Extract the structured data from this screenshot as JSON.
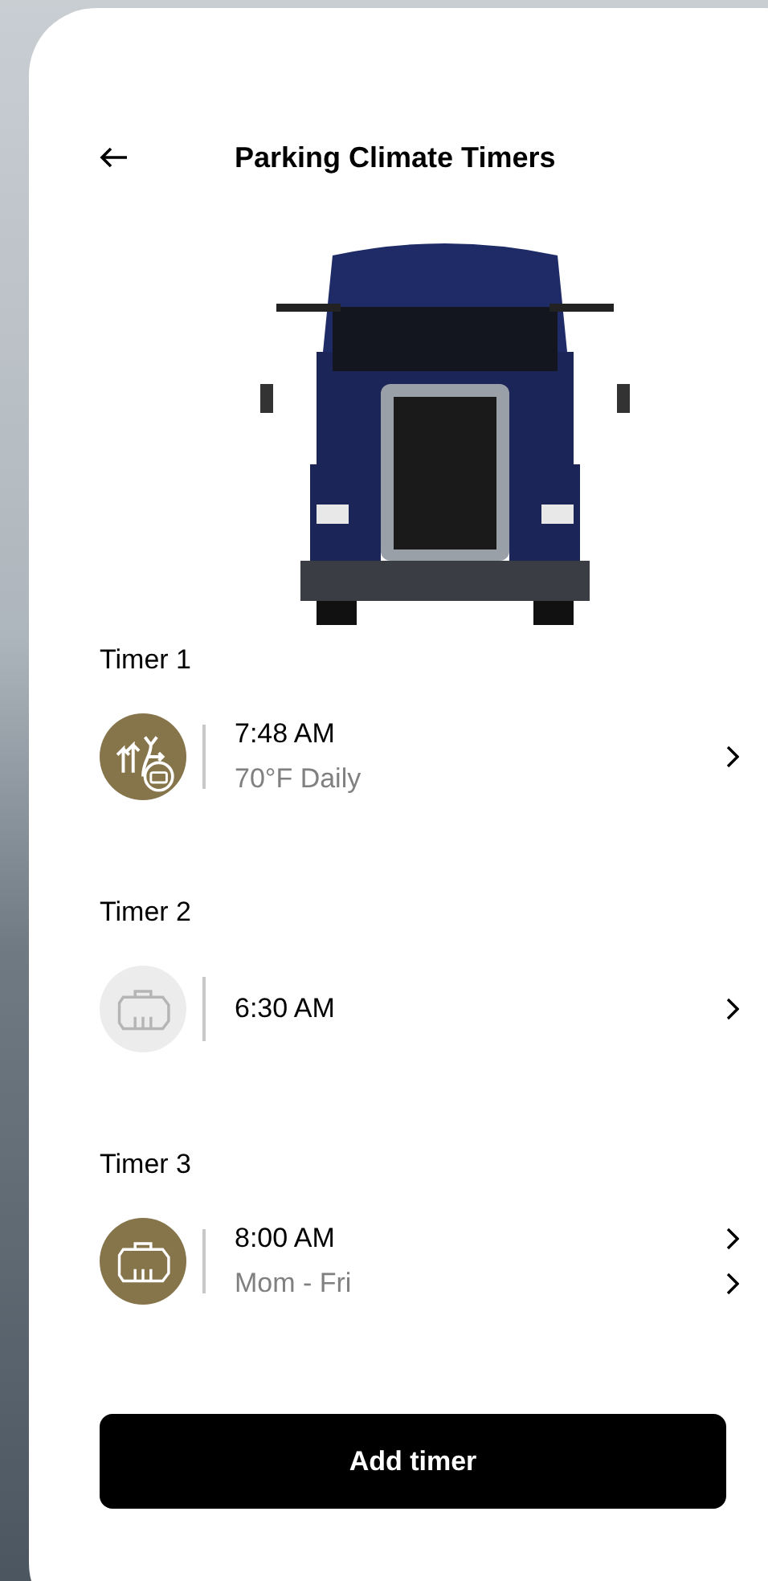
{
  "header": {
    "title": "Parking Climate Timers"
  },
  "timers": [
    {
      "label": "Timer 1",
      "kind": "climate",
      "active": true,
      "time": "7:48 AM",
      "detail": "70°F Daily",
      "chevrons": [
        {
          "kind": "chevron"
        }
      ]
    },
    {
      "label": "Timer 2",
      "kind": "engine",
      "active": false,
      "time": "6:30 AM",
      "chevrons": [
        {
          "kind": "chevron"
        }
      ]
    },
    {
      "label": "Timer 3",
      "kind": "engine",
      "active": true,
      "time": "8:00 AM",
      "detail": "Mom - Fri",
      "chevrons": [
        {
          "kind": "chevron"
        },
        {
          "kind": "chevron"
        }
      ]
    }
  ],
  "add_button": {
    "label": "Add timer"
  }
}
